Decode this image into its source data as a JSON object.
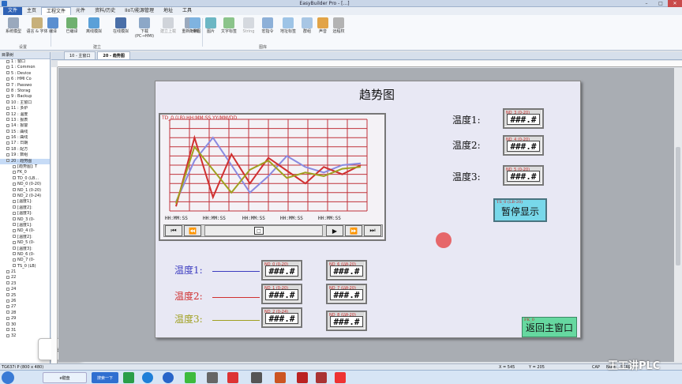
{
  "window": {
    "title": "EasyBuilder Pro - [...]",
    "min": "–",
    "max": "□",
    "close": "✕"
  },
  "menu": [
    "文件",
    "主页",
    "工程文件",
    "元件",
    "资料/历史",
    "IIoT/能源管理",
    "地址",
    "工具"
  ],
  "ribbon": {
    "buttons": [
      "系统模型",
      "语言 & 字体",
      "编译",
      "已编译",
      "离线模拟",
      "在线模拟",
      "下载 (PC→HMI)",
      "建立上载",
      "重新 HMI",
      "向量图",
      "图片",
      "文字标签",
      "String",
      "宏指令",
      "地址标签",
      "群组",
      "声音",
      "远程权"
    ],
    "group_settings": "设置",
    "group_build": "建立",
    "group_library": "图库"
  },
  "tree": {
    "header": "目录树",
    "items": [
      "1 : 窗口",
      "1 : Common",
      "5 : Device",
      "6 : HMI Co",
      "7 : Passwo",
      "8 : Storag",
      "9 : Backup",
      "10 : 主窗口",
      "11 : 多炉",
      "12 : 温度",
      "13 : 报表",
      "14 : 报警",
      "15 : 曲线",
      "16 : 曲线",
      "17 : 日期",
      "18 : 配方",
      "19 : 数组",
      "20 : 趋势图",
      "[趋势图]: T",
      "FK_0",
      "TD_0 (LB...",
      "ND_0 (0-20)",
      "ND_1 (0-20)",
      "ND_2 (0-24)",
      "[温度1]:",
      "[温度2]:",
      "[温度3]:",
      "ND_3 (0-",
      "[温度1]:",
      "ND_4 (0-",
      "[温度2]:",
      "ND_5 (0-",
      "[温度3]:",
      "ND_6 (0-",
      "ND_7 (0-",
      "TS_0 (LB)",
      "21",
      "22",
      "23",
      "24",
      "25",
      "26",
      "27",
      "28",
      "29",
      "30",
      "31",
      "32"
    ],
    "float_label": "e键盘"
  },
  "tabs": [
    "10 - 主窗口",
    "20 - 趋势图"
  ],
  "screen": {
    "title": "趋势图",
    "trend": {
      "id": "TD_0 (LB):HH:MM:SS YY/MM/DD",
      "time_labels": [
        "HH:MM:SS",
        "HH:MM:SS",
        "HH:MM:SS",
        "HH:MM:SS",
        "HH:MM:SS"
      ],
      "ctrl": [
        "⏮",
        "⏪",
        "▶",
        "⏩",
        "⏭"
      ],
      "knob": "□"
    },
    "right_labels": [
      "温度1:",
      "温度2:",
      "温度3:"
    ],
    "right_tags": [
      "ND_3 (0-20)",
      "ND_4 (0-20)",
      "ND_5 (0-20)"
    ],
    "legend_labels": [
      "温度1:",
      "温度2:",
      "温度3:"
    ],
    "legend_colors": [
      "#3c3cc0",
      "#d03030",
      "#a0a020"
    ],
    "mid_tags": [
      "ND_0 (0-20)",
      "ND_1 (0-20)",
      "ND_2 (0-24)"
    ],
    "far_tags": [
      "ND_6 (LW-20)",
      "ND_7 (LW-20)",
      "ND_8 (LW-20)"
    ],
    "field_value": "###.#",
    "pause_tag": "TS_0 (LB-20)",
    "pause_label": "暂停显示",
    "home_tag": "FK_0",
    "home_label": "返回主窗口"
  },
  "chart_data": {
    "type": "line",
    "series": [
      {
        "name": "温度1",
        "color": "#8a8ae0",
        "values": [
          10,
          55,
          80,
          50,
          20,
          38,
          60,
          48,
          42,
          50,
          52
        ]
      },
      {
        "name": "温度2",
        "color": "#d03030",
        "values": [
          5,
          80,
          15,
          62,
          30,
          58,
          44,
          30,
          48,
          40,
          50
        ]
      },
      {
        "name": "温度3",
        "color": "#a0a020",
        "values": [
          8,
          70,
          45,
          20,
          45,
          55,
          36,
          42,
          38,
          46,
          48
        ]
      }
    ],
    "ylim": [
      0,
      100
    ]
  },
  "status": {
    "left": "TG637i P (800 x 480)",
    "x": "X = 545",
    "y": "Y = 205",
    "caps": "CAP",
    "num": "NUM",
    "scrl": "SCRL"
  },
  "taskbar": {
    "items": [
      "e键盘",
      "搜索一下"
    ],
    "watermark": "王工讲PLC"
  }
}
